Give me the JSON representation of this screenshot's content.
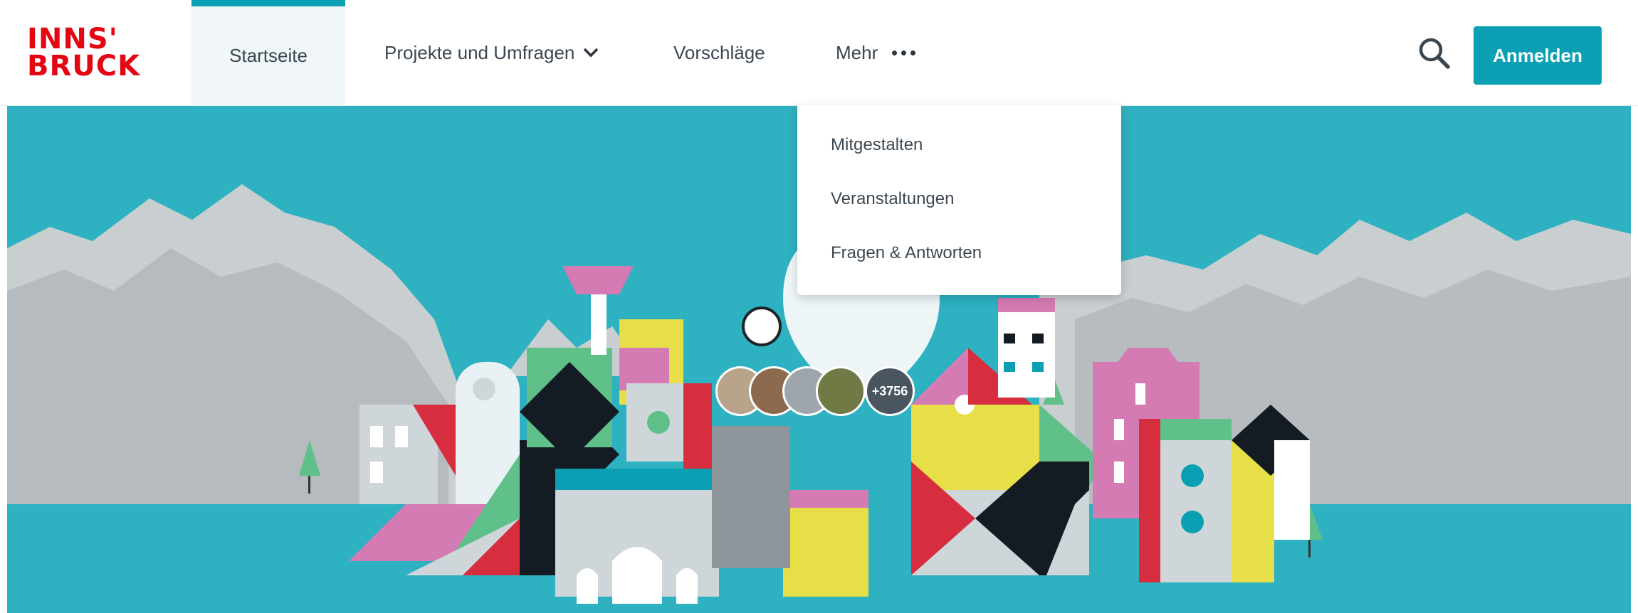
{
  "brand": {
    "line1": "INNS'",
    "line2": "BRUCK",
    "color": "#e30613"
  },
  "nav": {
    "home": "Startseite",
    "projects": "Projekte und Umfragen",
    "suggestions": "Vorschläge",
    "more": "Mehr"
  },
  "more_menu": {
    "items": [
      "Mitgestalten",
      "Veranstaltungen",
      "Fragen & Antworten"
    ]
  },
  "actions": {
    "login": "Anmelden",
    "search_icon": "search-icon"
  },
  "hero": {
    "participant_count": "+3756"
  },
  "colors": {
    "accent": "#0a9fb3",
    "hero_bg": "#2eb1c0"
  }
}
